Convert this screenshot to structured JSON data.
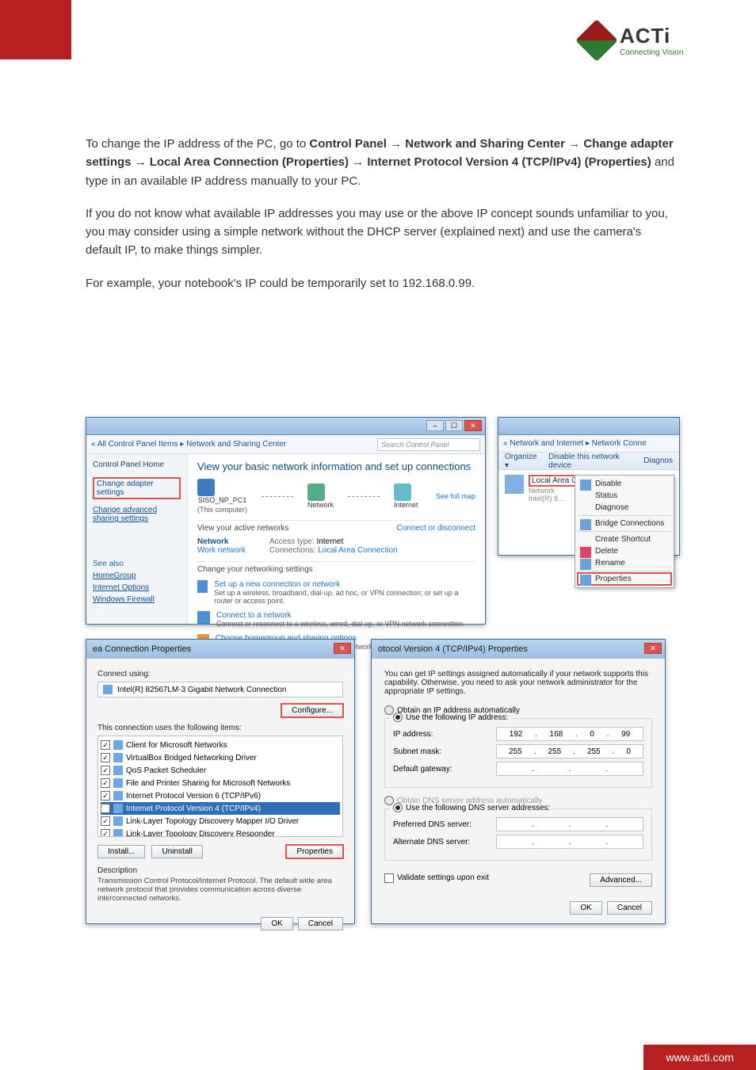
{
  "logo": {
    "brand": "ACTi",
    "tagline": "Connecting Vision"
  },
  "body": {
    "p1a": "To change the IP address of the PC, go to ",
    "p1b": "Control Panel",
    "p1c": " → ",
    "p1d": "Network and Sharing Center",
    "p1e": " → ",
    "p1f": "Change adapter settings",
    "p1g": " → ",
    "p1h": "Local Area Connection (Properties)",
    "p1i": " → ",
    "p1j": "Internet Protocol Version 4 (TCP/IPv4) (Properties)",
    "p1k": " and type in an available IP address manually to your PC.",
    "p2": "If you do not know what available IP addresses you may use or the above IP concept sounds unfamiliar to you, you may consider using a simple network without the DHCP server (explained next) and use the camera's default IP, to make things simpler.",
    "p3": "For example, your notebook's IP could be temporarily set to 192.168.0.99."
  },
  "win1": {
    "crumb_prefix": "« All Control Panel Items ▸ ",
    "crumb_current": "Network and Sharing Center",
    "search_placeholder": "Search Control Panel",
    "left": {
      "heading": "Control Panel Home",
      "link1": "Change adapter settings",
      "link2": "Change advanced sharing settings",
      "see_also": "See also",
      "sa1": "HomeGroup",
      "sa2": "Internet Options",
      "sa3": "Windows Firewall"
    },
    "right": {
      "title": "View your basic network information and set up connections",
      "see_full": "See full map",
      "node1": "SISO_NP_PC1",
      "node1_sub": "(This computer)",
      "node2": "Network",
      "node3": "Internet",
      "sect1": "View your active networks",
      "sect1_link": "Connect or disconnect",
      "netname": "Network",
      "nettype": "Work network",
      "access_k": "Access type:",
      "access_v": "Internet",
      "conn_k": "Connections:",
      "conn_v": "Local Area Connection",
      "sect2": "Change your networking settings",
      "s2a_t": "Set up a new connection or network",
      "s2a_d": "Set up a wireless, broadband, dial-up, ad hoc, or VPN connection; or set up a router or access point.",
      "s2b_t": "Connect to a network",
      "s2b_d": "Connect or reconnect to a wireless, wired, dial-up, or VPN network connection.",
      "s2c_t": "Choose homegroup and sharing options",
      "s2c_d": "Access files and printers located on other network computers, or change sharing settings."
    }
  },
  "win2": {
    "crumb": "« Network and Internet ▸ Network Conne",
    "organize": "Organize ▾",
    "tb_disable": "Disable this network device",
    "tb_diag": "Diagnos",
    "lac": "Local Area Connection",
    "lac_sub1": "Network",
    "lac_sub2": "Intel(R) 8…",
    "menu": {
      "disable": "Disable",
      "status": "Status",
      "diagnose": "Diagnose",
      "bridge": "Bridge Connections",
      "shortcut": "Create Shortcut",
      "delete": "Delete",
      "rename": "Rename",
      "properties": "Properties"
    }
  },
  "win3": {
    "title": "ea Connection Properties",
    "connect_using": "Connect using:",
    "adapter": "Intel(R) 82567LM-3 Gigabit Network Connection",
    "configure": "Configure...",
    "uses": "This connection uses the following items:",
    "items": [
      "Client for Microsoft Networks",
      "VirtualBox Bridged Networking Driver",
      "QoS Packet Scheduler",
      "File and Printer Sharing for Microsoft Networks",
      "Internet Protocol Version 6 (TCP/IPv6)",
      "Internet Protocol Version 4 (TCP/IPv4)",
      "Link-Layer Topology Discovery Mapper I/O Driver",
      "Link-Layer Topology Discovery Responder"
    ],
    "install": "Install...",
    "uninstall": "Uninstall",
    "properties": "Properties",
    "desc_lbl": "Description",
    "desc": "Transmission Control Protocol/Internet Protocol. The default wide area network protocol that provides communication across diverse interconnected networks.",
    "ok": "OK",
    "cancel": "Cancel"
  },
  "win4": {
    "title": "otocol Version 4 (TCP/IPv4) Properties",
    "info": "You can get IP settings assigned automatically if your network supports this capability. Otherwise, you need to ask your network administrator for the appropriate IP settings.",
    "r1": "Obtain an IP address automatically",
    "r2": "Use the following IP address:",
    "ip_lbl": "IP address:",
    "ip": [
      "192",
      "168",
      "0",
      "99"
    ],
    "mask_lbl": "Subnet mask:",
    "mask": [
      "255",
      "255",
      "255",
      "0"
    ],
    "gw_lbl": "Default gateway:",
    "gw": [
      ".",
      ".",
      ".",
      ""
    ],
    "r3": "Obtain DNS server address automatically",
    "r4": "Use the following DNS server addresses:",
    "pdns_lbl": "Preferred DNS server:",
    "adns_lbl": "Alternate DNS server:",
    "validate": "Validate settings upon exit",
    "advanced": "Advanced...",
    "ok": "OK",
    "cancel": "Cancel"
  },
  "footer": "www.acti.com"
}
